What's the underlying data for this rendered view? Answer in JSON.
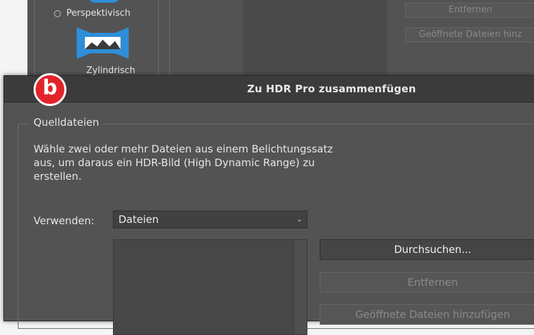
{
  "background_dialog": {
    "radio_label": "Perspektivisch",
    "projection_label": "Zylindrisch",
    "remove_label": "Entfernen",
    "add_open_label": "Geöffnete Dateien hinz"
  },
  "badge": {
    "letter": "b",
    "color": "#e2242a"
  },
  "dialog": {
    "title": "Zu HDR Pro zusammenfügen",
    "source_group": {
      "legend": "Quelldateien",
      "description": "Wähle zwei oder mehr Dateien aus einem Belichtungssatz aus, um daraus ein HDR-Bild (High Dynamic Range) zu erstellen.",
      "use_label": "Verwenden:",
      "use_value": "Dateien",
      "files": []
    },
    "buttons": {
      "browse": "Durchsuchen...",
      "remove": "Entfernen",
      "add_open": "Geöffnete Dateien hinzufügen"
    }
  },
  "icons": {
    "chevron": "chevron-down-icon",
    "projection": "cylindrical-projection-icon"
  }
}
